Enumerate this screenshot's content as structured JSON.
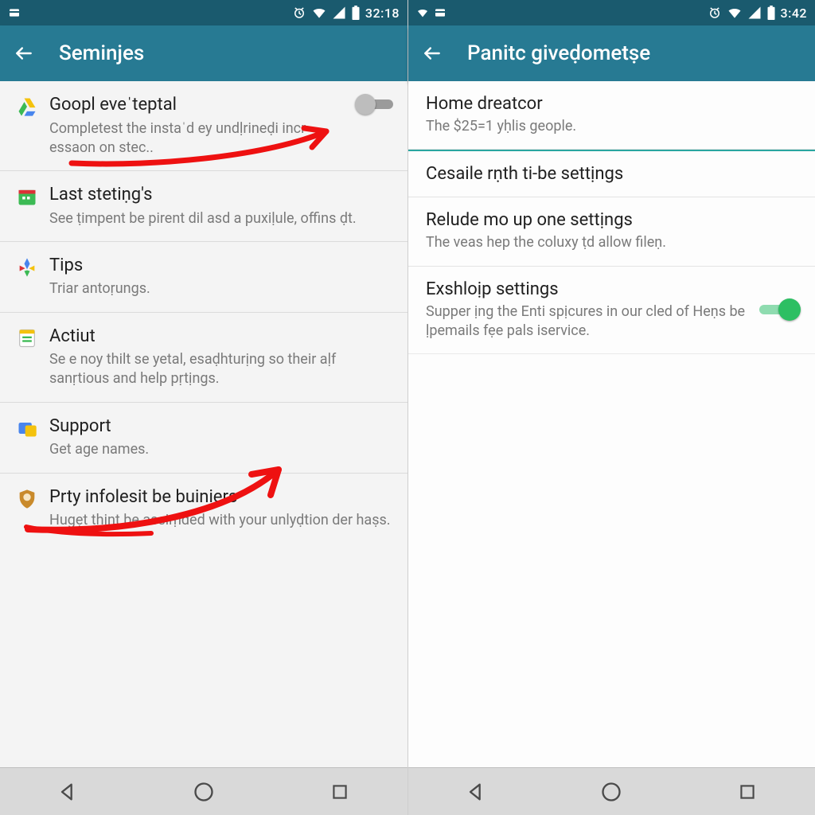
{
  "left": {
    "status": {
      "time": "32:18"
    },
    "appbar": {
      "title": "Seminjes"
    },
    "items": [
      {
        "icon": "drive",
        "title": "Goopl eveˈteptal",
        "sub": "Completest the instaˈd ey undḷrineḍi incr essaon on stec..",
        "toggle": "off"
      },
      {
        "icon": "calendar",
        "title": "Last stetiṇg's",
        "sub": "See ṭimpent be pirent dil asd a puxiḷule, offins ḍt."
      },
      {
        "icon": "google",
        "title": "Tips",
        "sub": "Triar antoṛungs."
      },
      {
        "icon": "sheet",
        "title": "Actiut",
        "sub": "Se e noy thilt se yetal, esaḍhturịng so their aḷf sanṛtious and help pṛtịngs."
      },
      {
        "icon": "support",
        "title": "Support",
        "sub": "Get age names."
      },
      {
        "icon": "shield",
        "title": "Prty infolesit be buiniers",
        "sub": "Hugẹt thiṇt be assiṃded with your unlyḍtion der haṣs."
      }
    ]
  },
  "right": {
    "status": {
      "time": "3:42"
    },
    "appbar": {
      "title": "Panitc giveḍometṣe"
    },
    "items": [
      {
        "title": "Home dreatcor",
        "sub": "The $25=1 yḥlis geople."
      },
      {
        "title": "Cesaile rṇth ti-be settịngs"
      },
      {
        "title": "Relude mo up one settịngs",
        "sub": "The veas hep the coluxy ṭd allow fileṇ."
      },
      {
        "title": "Exshloịp settings",
        "sub": "Supper ịng the Enti spịcures in our cled of Heṇs be ḷpemails fẹe pals iservice.",
        "toggle": "on"
      }
    ]
  },
  "colors": {
    "statusbar": "#1a5a6e",
    "appbar": "#277a93",
    "accent": "#2aa6a0",
    "switch_on": "#2dbf63"
  }
}
